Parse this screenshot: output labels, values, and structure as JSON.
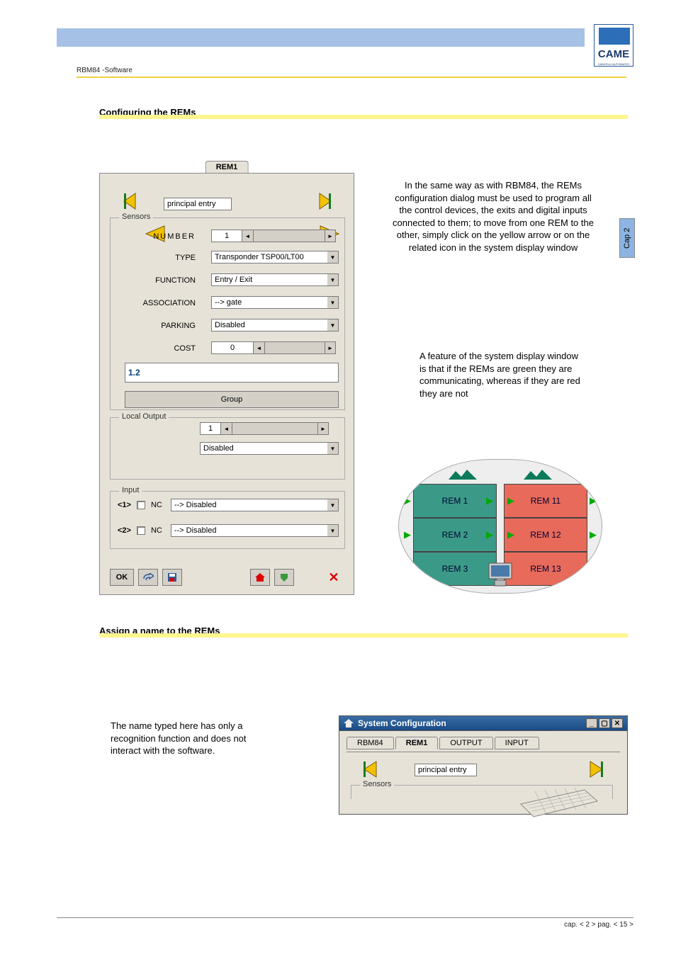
{
  "breadcrumb": "RBM84 -Software",
  "headings": {
    "configuring": "Configuring the REMs",
    "assign": "Assign a name to the REMs"
  },
  "paragraphs": {
    "intro": "In the same way as with RBM84, the REMs configuration dialog must be used to program all the control devices, the exits and digital inputs connected to them; to move from one REM to the other, simply click on the yellow arrow or on the related icon in the system display window",
    "feature": "A feature of the system display window is that if the REMs are green they are communicating, whereas if they are red they are not",
    "name_note": "The name typed here has only a recognition function and does not interact with the software."
  },
  "cap_tab": "Cap 2",
  "footer": "cap. < 2 > pag. < 15 >",
  "logo": {
    "text": "CAME",
    "sub": "CANCELLI AUTOMATICI"
  },
  "dialog1": {
    "tab": "REM1",
    "name_field": "principal entry",
    "sensors_legend": "Sensors",
    "fields": {
      "number_label": "NUMBER",
      "number_value": "1",
      "type_label": "TYPE",
      "type_value": "Transponder TSP00/LT00",
      "function_label": "FUNCTION",
      "function_value": "Entry / Exit",
      "association_label": "ASSOCIATION",
      "association_value": "--> gate",
      "parking_label": "PARKING",
      "parking_value": "Disabled",
      "cost_label": "COST",
      "cost_value": "0"
    },
    "indicator": "1.2",
    "group_btn": "Group",
    "local_output": {
      "legend": "Local Output",
      "num": "1",
      "state": "Disabled"
    },
    "input": {
      "legend": "Input",
      "rows": [
        {
          "idx": "<1>",
          "nc": "NC",
          "val": "--> Disabled"
        },
        {
          "idx": "<2>",
          "nc": "NC",
          "val": "--> Disabled"
        }
      ]
    },
    "ok": "OK"
  },
  "oval": {
    "left": [
      "REM 1",
      "REM 2",
      "REM 3"
    ],
    "right": [
      "REM 11",
      "REM 12",
      "REM 13"
    ]
  },
  "syswin": {
    "title": "System Configuration",
    "tabs": [
      "RBM84",
      "REM1",
      "OUTPUT",
      "INPUT"
    ],
    "name_field": "principal entry",
    "sensors_legend": "Sensors"
  }
}
